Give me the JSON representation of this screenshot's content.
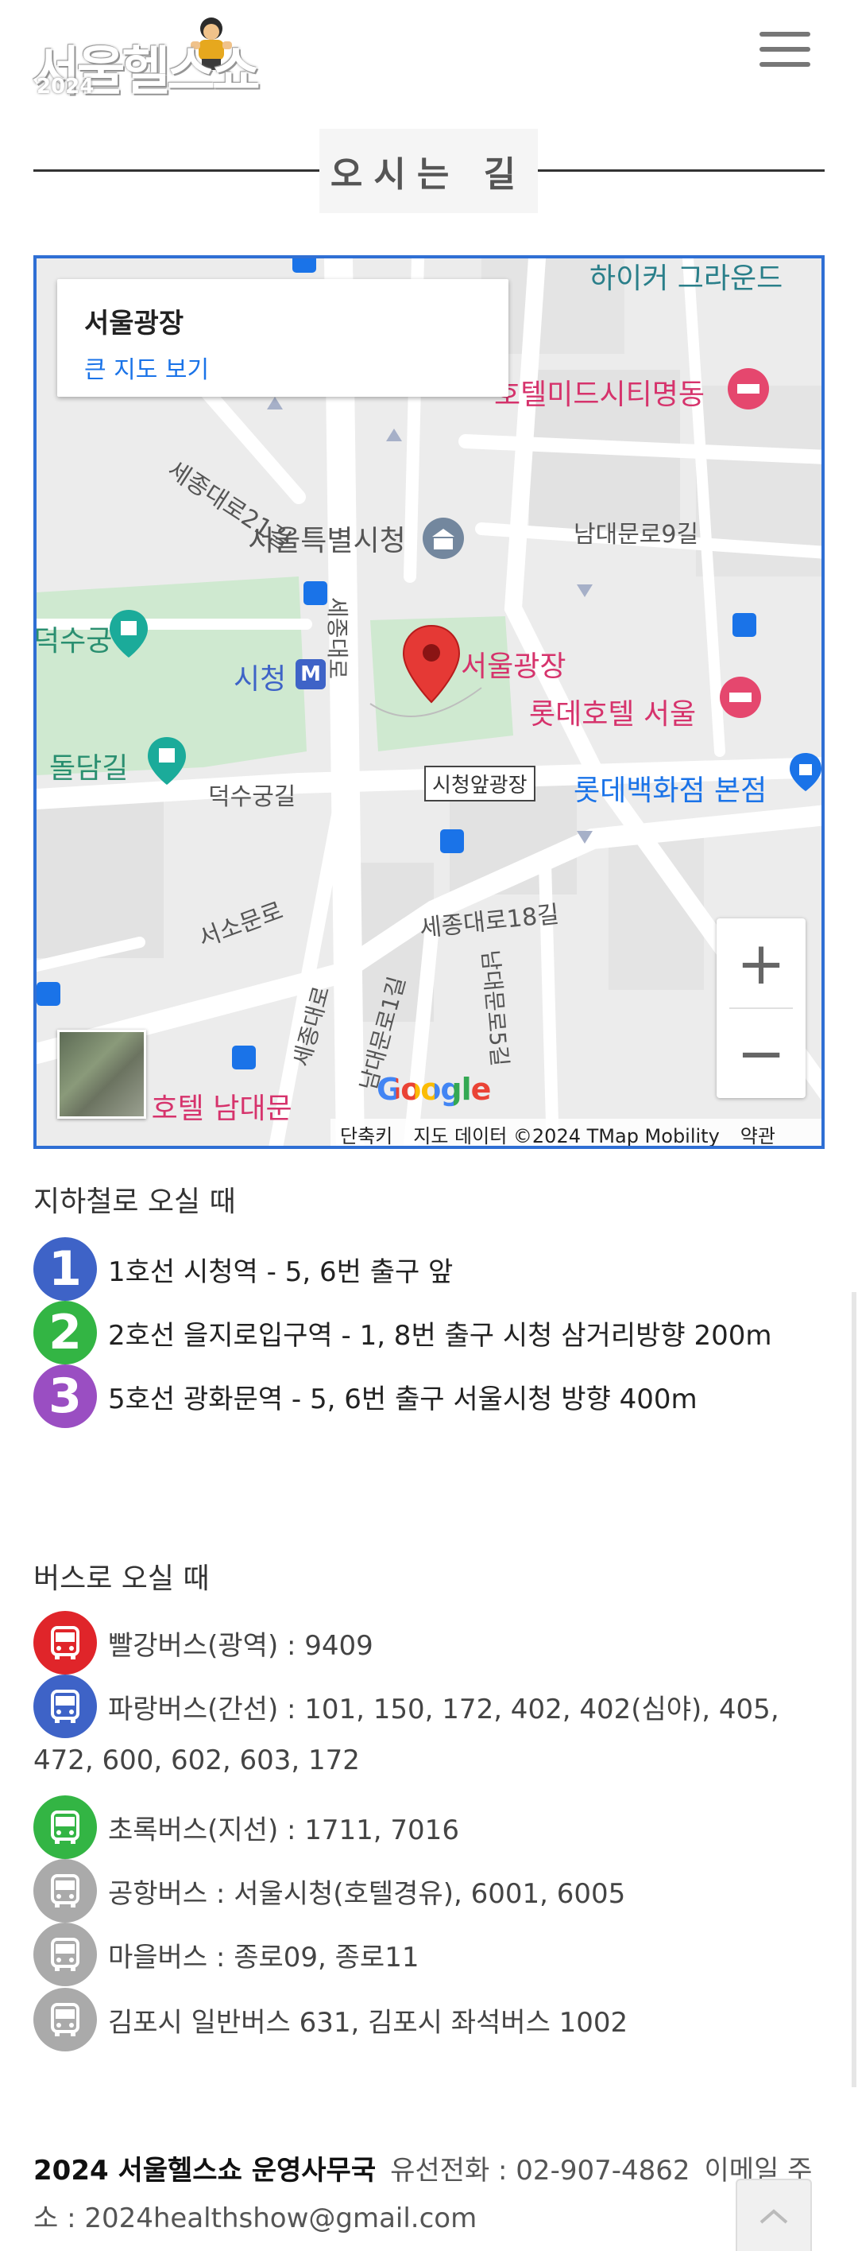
{
  "header": {
    "logo_text": "서울헬스쇼",
    "logo_year": "2024",
    "menu_icon": "hamburger-menu-icon"
  },
  "section": {
    "title": "오시는 길"
  },
  "map": {
    "place_name": "서울광장",
    "large_map_link": "큰 지도 보기",
    "labels": {
      "hiker_ground": "하이커 그라운드",
      "hotel_midcity": "호텔미드시티명동",
      "sejong_21": "세종대로21길",
      "city_hall": "서울특별시청",
      "namdaemun_9": "남대문로9길",
      "deoksugung": "덕수궁",
      "sejong_daero": "세종대로",
      "sicheong_station": "시청",
      "seoul_plaza": "서울광장",
      "lotte_hotel": "롯데호텔 서울",
      "doldam": "돌담길",
      "deoksugung_gil": "덕수궁길",
      "plaza_front": "시청앞광장",
      "lotte_dept": "롯데백화점 본점",
      "seosomun": "서소문로",
      "sejong_18": "세종대로18길",
      "sejong_daero2": "세종대로",
      "namdaemun_1": "남대문로1길",
      "namdaemun_5": "남대문로5길",
      "hotel_namdaemun": "트 호텔 남대문"
    },
    "zoom_in": "+",
    "zoom_out": "−",
    "google": "Google",
    "attribution": {
      "shortcut": "단축키",
      "data": "지도 데이터 ©2024 TMap Mobility",
      "terms": "약관"
    }
  },
  "subway": {
    "heading": "지하철로 오실 때",
    "lines": [
      {
        "badge": "1",
        "color": "#3e63c7",
        "text": "1호선 시청역 - 5, 6번 출구 앞"
      },
      {
        "badge": "2",
        "color": "#33b544",
        "text": "2호선 을지로입구역 - 1, 8번 출구 시청 삼거리방향 200m"
      },
      {
        "badge": "3",
        "color": "#9a4ec2",
        "text": "5호선 광화문역 - 5, 6번 출구 서울시청 방향 400m"
      }
    ]
  },
  "bus": {
    "heading": "버스로 오실 때",
    "items": [
      {
        "color": "#e0252a",
        "text": "빨강버스(광역) : 9409",
        "cont": ""
      },
      {
        "color": "#3e63c7",
        "text": "파랑버스(간선) : 101, 150, 172, 402, 402(심야), 405,",
        "cont": "472, 600, 602, 603, 172"
      },
      {
        "color": "#33b544",
        "text": "초록버스(지선) : 1711, 7016",
        "cont": ""
      },
      {
        "color": "#aaaaaa",
        "text": "공항버스 : 서울시청(호텔경유), 6001, 6005",
        "cont": ""
      },
      {
        "color": "#aaaaaa",
        "text": "마을버스 : 종로09, 종로11",
        "cont": ""
      },
      {
        "color": "#aaaaaa",
        "text": "김포시 일반버스 631, 김포시 좌석버스 1002",
        "cont": ""
      }
    ]
  },
  "footer": {
    "org": "2024 서울헬스쇼 운영사무국",
    "phone": "유선전화 : 02-907-4862",
    "email_label": "이메일 주",
    "email_cont": "소 : 2024healthshow@gmail.com"
  },
  "colors": {
    "map_border": "#2f6fd4",
    "map_label_red": "#d6336c",
    "map_label_blue": "#1a73e8",
    "map_link": "#1a73e8"
  }
}
